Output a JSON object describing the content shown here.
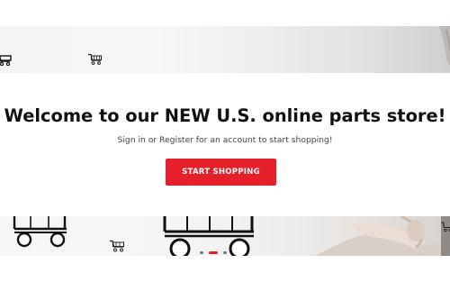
{
  "hero": {
    "headline": "Welcome to our NEW U.S. online parts store!",
    "subtext": "Sign in or Register for an account to start shopping!",
    "cta_label": "START SHOPPING"
  },
  "carousel": {
    "slide_count": 3,
    "active_index": 0
  },
  "colors": {
    "accent": "#e5202b",
    "headline": "#111111",
    "subtext": "#444444",
    "background": "#ffffff"
  },
  "icons": [
    "shopping-cart-icon"
  ]
}
